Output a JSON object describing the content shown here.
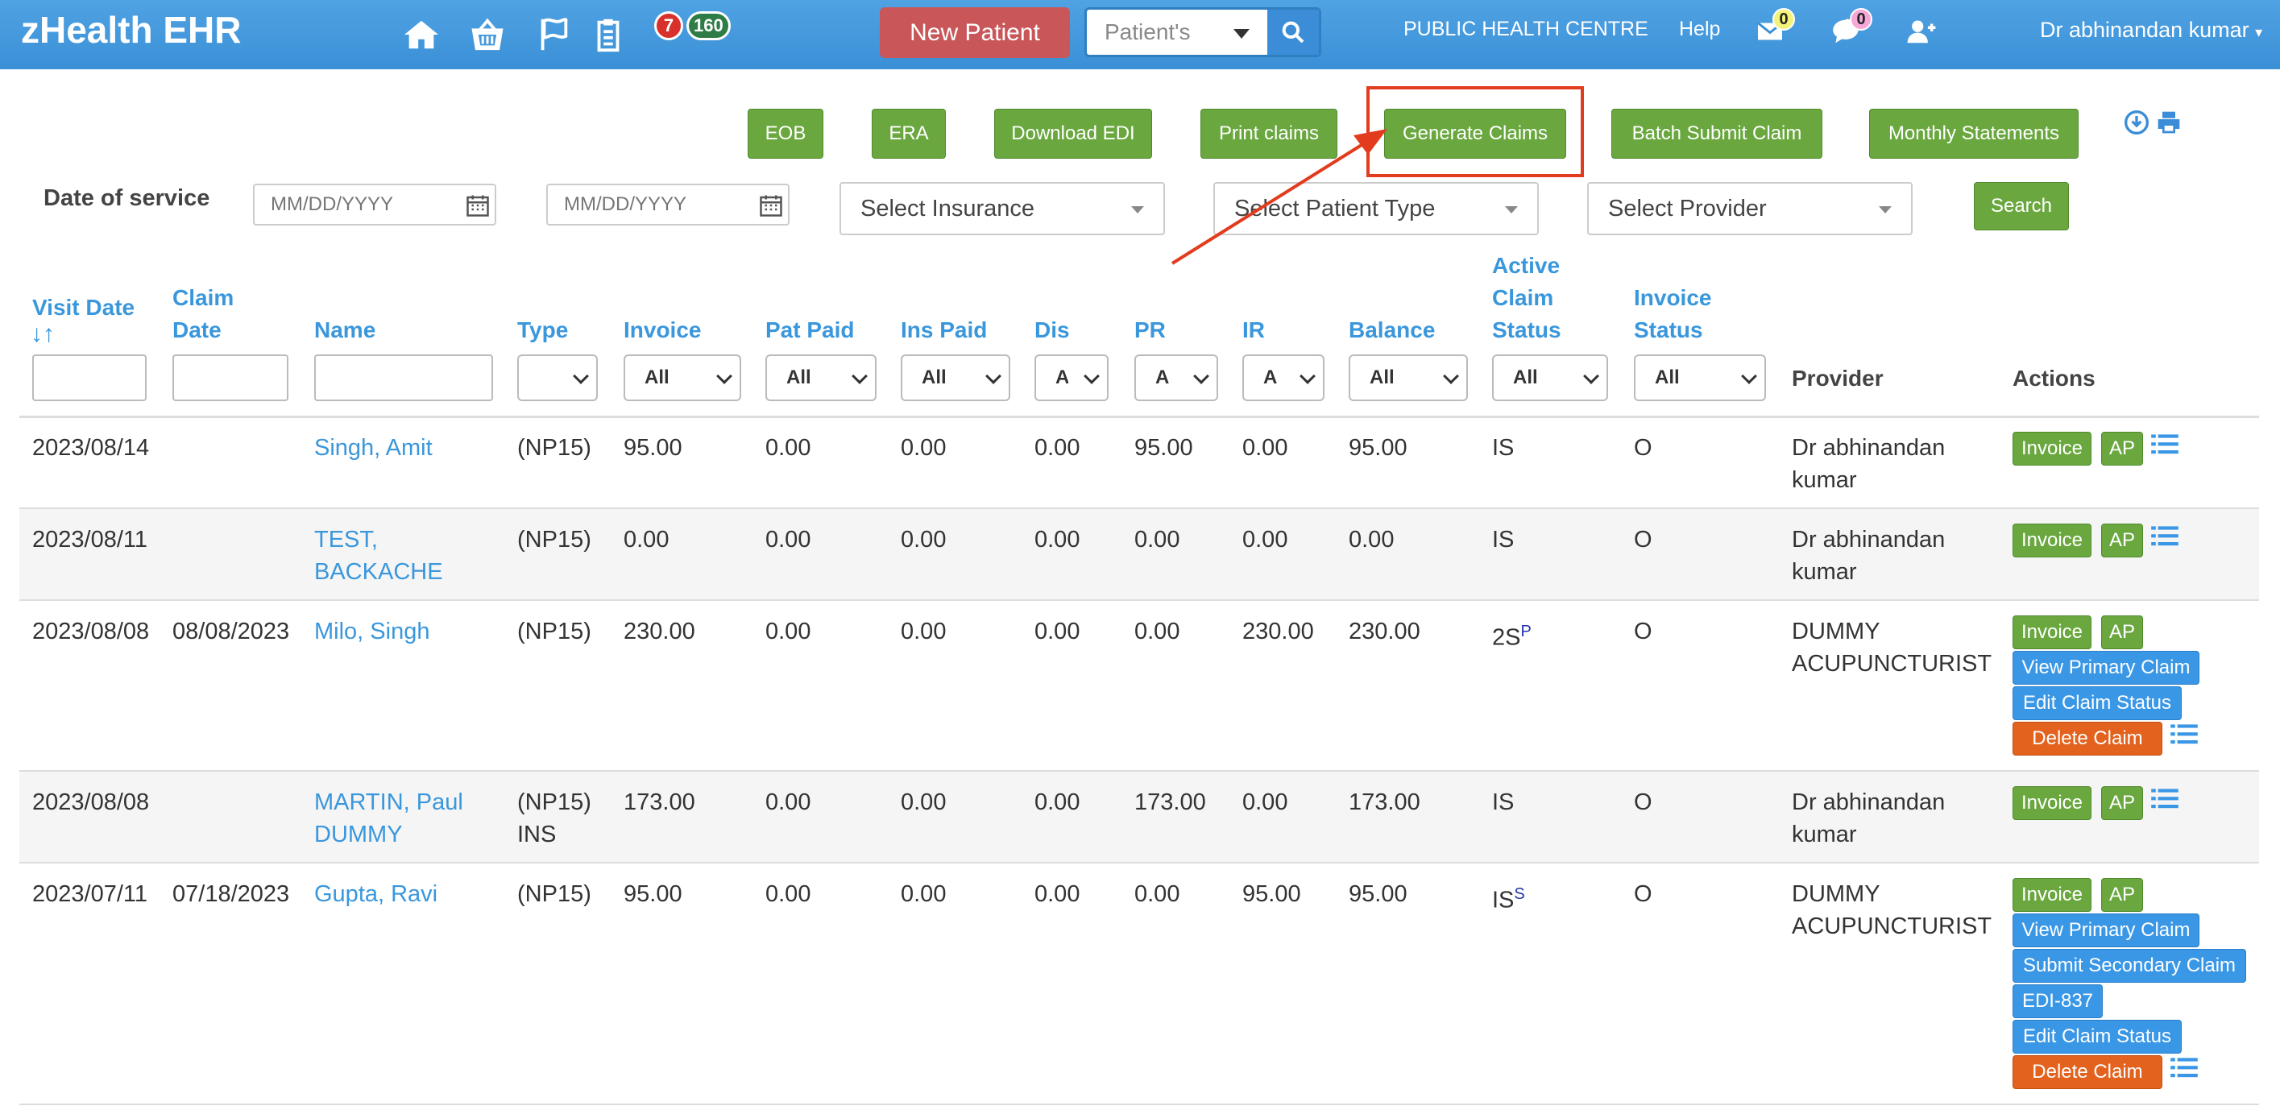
{
  "app": {
    "title": "zHealth EHR"
  },
  "nav": {
    "badge_red": "7",
    "badge_green": "160",
    "new_patient": "New Patient",
    "search_placeholder": "Patient's",
    "facility": "PUBLIC HEALTH CENTRE",
    "help": "Help",
    "mail_count": "0",
    "chat_count": "0",
    "user": "Dr abhinandan kumar"
  },
  "toolbar": {
    "eob": "EOB",
    "era": "ERA",
    "download_edi": "Download EDI",
    "print_claims": "Print claims",
    "generate_claims": "Generate Claims",
    "batch_submit": "Batch Submit Claim",
    "monthly_statements": "Monthly Statements"
  },
  "filters": {
    "date_label": "Date of service",
    "date_placeholder": "MM/DD/YYYY",
    "insurance": "Select Insurance",
    "patient_type": "Select Patient Type",
    "provider": "Select Provider",
    "search": "Search"
  },
  "table": {
    "headers": {
      "visit_date": "Visit Date",
      "claim_date_1": "Claim",
      "claim_date_2": "Date",
      "name": "Name",
      "type": "Type",
      "invoice": "Invoice",
      "pat_paid": "Pat Paid",
      "ins_paid": "Ins Paid",
      "dis": "Dis",
      "pr": "PR",
      "ir": "IR",
      "balance": "Balance",
      "acs_1": "Active",
      "acs_2": "Claim",
      "acs_3": "Status",
      "is_1": "Invoice",
      "is_2": "Status",
      "provider": "Provider",
      "actions": "Actions"
    },
    "filter_all": "All",
    "filter_a": "A",
    "rows": [
      {
        "visit": "2023/08/14",
        "claim": "",
        "name1": "Singh, Amit",
        "name2": "",
        "type1": "(NP15)",
        "type2": "",
        "invoice": "95.00",
        "pat": "0.00",
        "ins": "0.00",
        "dis": "0.00",
        "pr": "95.00",
        "ir": "0.00",
        "bal": "95.00",
        "acs": "IS",
        "acs_sup": "",
        "inv_status": "O",
        "prov1": "Dr abhinandan",
        "prov2": "kumar"
      },
      {
        "visit": "2023/08/11",
        "claim": "",
        "name1": "TEST,",
        "name2": "BACKACHE",
        "type1": "(NP15)",
        "type2": "",
        "invoice": "0.00",
        "pat": "0.00",
        "ins": "0.00",
        "dis": "0.00",
        "pr": "0.00",
        "ir": "0.00",
        "bal": "0.00",
        "acs": "IS",
        "acs_sup": "",
        "inv_status": "O",
        "prov1": "Dr abhinandan",
        "prov2": "kumar"
      },
      {
        "visit": "2023/08/08",
        "claim": "08/08/2023",
        "name1": "Milo, Singh",
        "name2": "",
        "type1": "(NP15)",
        "type2": "",
        "invoice": "230.00",
        "pat": "0.00",
        "ins": "0.00",
        "dis": "0.00",
        "pr": "0.00",
        "ir": "230.00",
        "bal": "230.00",
        "acs": "2S",
        "acs_sup": "P",
        "inv_status": "O",
        "prov1": "DUMMY",
        "prov2": "ACUPUNCTURIST"
      },
      {
        "visit": "2023/08/08",
        "claim": "",
        "name1": "MARTIN, Paul",
        "name2": "DUMMY",
        "type1": "(NP15)",
        "type2": "INS",
        "invoice": "173.00",
        "pat": "0.00",
        "ins": "0.00",
        "dis": "0.00",
        "pr": "173.00",
        "ir": "0.00",
        "bal": "173.00",
        "acs": "IS",
        "acs_sup": "",
        "inv_status": "O",
        "prov1": "Dr abhinandan",
        "prov2": "kumar"
      },
      {
        "visit": "2023/07/11",
        "claim": "07/18/2023",
        "name1": "Gupta, Ravi",
        "name2": "",
        "type1": "(NP15)",
        "type2": "",
        "invoice": "95.00",
        "pat": "0.00",
        "ins": "0.00",
        "dis": "0.00",
        "pr": "0.00",
        "ir": "95.00",
        "bal": "95.00",
        "acs": "IS",
        "acs_sup": "S",
        "inv_status": "O",
        "prov1": "DUMMY",
        "prov2": "ACUPUNCTURIST"
      }
    ],
    "actions": {
      "invoice": "Invoice",
      "ap": "AP",
      "view_primary": "View Primary Claim",
      "edit_status": "Edit Claim Status",
      "delete": "Delete Claim",
      "submit_secondary": "Submit Secondary Claim",
      "edi": "EDI-837"
    }
  },
  "colors": {
    "navbar": "#3b8fd6",
    "green_button": "#6aa83f",
    "blue_button": "#3a97e6",
    "orange_button": "#e2621e",
    "new_patient": "#c9575a",
    "highlight": "#e23b1e"
  }
}
